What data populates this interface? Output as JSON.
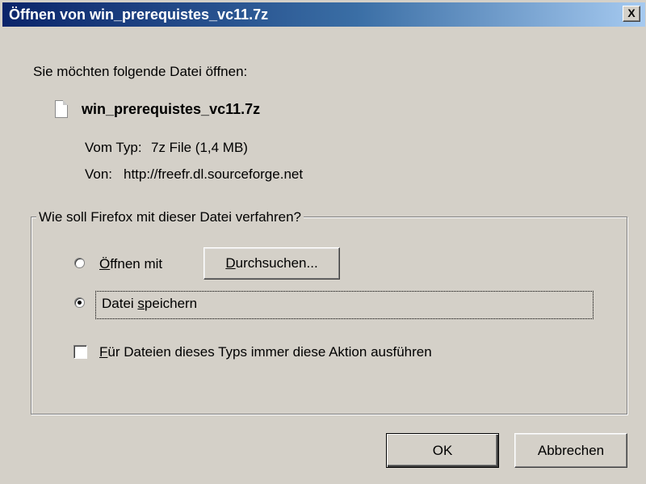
{
  "window": {
    "title": "Öffnen von win_prerequistes_vc11.7z",
    "close_label": "X"
  },
  "prompt": "Sie möchten folgende Datei öffnen:",
  "file": {
    "name": "win_prerequistes_vc11.7z",
    "type_label": "Vom Typ:",
    "type_value": "7z File (1,4 MB)",
    "from_label": "Von:",
    "from_value": "http://freefr.dl.sourceforge.net"
  },
  "action_group": {
    "legend": "Wie soll Firefox mit dieser Datei verfahren?",
    "open_with": {
      "accesskey": "Ö",
      "label_rest": "ffnen mit",
      "selected": false
    },
    "browse_button": {
      "accesskey": "D",
      "label_rest": "urchsuchen..."
    },
    "save_file": {
      "label_start": "Datei ",
      "accesskey": "s",
      "label_rest": "peichern",
      "selected": true
    },
    "remember_choice": {
      "accesskey": "F",
      "label_rest": "ür Dateien dieses Typs immer diese Aktion ausführen",
      "checked": false
    }
  },
  "buttons": {
    "ok": "OK",
    "cancel": "Abbrechen"
  }
}
